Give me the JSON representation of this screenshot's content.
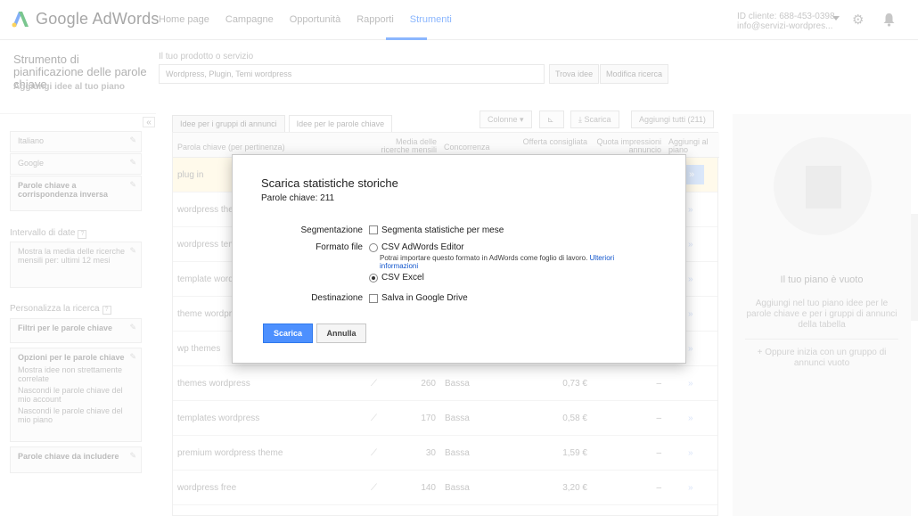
{
  "header": {
    "logo_text": "Google AdWords",
    "nav": [
      "Home page",
      "Campagne",
      "Opportunità",
      "Rapporti",
      "Strumenti"
    ],
    "active_nav": "Strumenti",
    "account_id": "ID cliente: 688-453-0398",
    "account_email": "info@servizi-wordpres..."
  },
  "tool": {
    "title": "Strumento di pianificazione delle parole chiave",
    "subtitle": "Aggiungi idee al tuo piano",
    "product_label": "Il tuo prodotto o servizio",
    "product_value": "Wordpress, Plugin, Temi wordpress",
    "find_ideas": "Trova idee",
    "edit_search": "Modifica ricerca"
  },
  "sidebar": {
    "language": "Italiano",
    "network": "Google",
    "negative_keywords": "Parole chiave a corrispondenza inversa",
    "date_range_head": "Intervallo di date",
    "date_range_text": "Mostra la media delle ricerche mensili per: ultimi 12 mesi",
    "customize_head": "Personalizza la ricerca",
    "keyword_filters": "Filtri per le parole chiave",
    "keyword_options": "Opzioni per le parole chiave",
    "opt1": "Mostra idee non strettamente correlate",
    "opt2": "Nascondi le parole chiave del mio account",
    "opt3": "Nascondi le parole chiave del mio piano",
    "include_keywords": "Parole chiave da includere"
  },
  "main": {
    "tab_groups": "Idee per i gruppi di annunci",
    "tab_keywords": "Idee per le parole chiave",
    "columns_btn": "Colonne",
    "download_btn": "Scarica",
    "add_all_btn": "Aggiungi tutti (211)",
    "headers": {
      "keyword": "Parola chiave (per pertinenza)",
      "volume": "Media delle ricerche mensili",
      "competition": "Concorrenza",
      "bid": "Offerta consigliata",
      "share": "Quota impressioni annuncio",
      "add": "Aggiungi al piano"
    },
    "rows": [
      {
        "keyword": "plug in",
        "volume": "",
        "competition": "",
        "bid": "",
        "share": ""
      },
      {
        "keyword": "wordpress themes",
        "volume": "",
        "competition": "",
        "bid": "",
        "share": ""
      },
      {
        "keyword": "wordpress templates",
        "volume": "",
        "competition": "",
        "bid": "",
        "share": ""
      },
      {
        "keyword": "template wordpress",
        "volume": "",
        "competition": "",
        "bid": "",
        "share": ""
      },
      {
        "keyword": "theme wordpress",
        "volume": "",
        "competition": "",
        "bid": "",
        "share": ""
      },
      {
        "keyword": "wp themes",
        "volume": "",
        "competition": "",
        "bid": "",
        "share": ""
      },
      {
        "keyword": "themes wordpress",
        "volume": "260",
        "competition": "Bassa",
        "bid": "0,73 €",
        "share": "–"
      },
      {
        "keyword": "templates wordpress",
        "volume": "170",
        "competition": "Bassa",
        "bid": "0,58 €",
        "share": "–"
      },
      {
        "keyword": "premium wordpress theme",
        "volume": "30",
        "competition": "Bassa",
        "bid": "1,59 €",
        "share": "–"
      },
      {
        "keyword": "wordpress free",
        "volume": "140",
        "competition": "Bassa",
        "bid": "3,20 €",
        "share": "–"
      }
    ]
  },
  "plan": {
    "empty_title": "Il tuo piano è vuoto",
    "empty_desc": "Aggiungi nel tuo piano idee per le parole chiave e per i gruppi di annunci della tabella",
    "alt_text": "+ Oppure inizia con un gruppo di annunci vuoto"
  },
  "dialog": {
    "title": "Scarica statistiche storiche",
    "keyword_count": "Parole chiave: 211",
    "segmentation_label": "Segmentazione",
    "segmentation_option": "Segmenta statistiche per mese",
    "format_label": "Formato file",
    "format_editor": "CSV AdWords Editor",
    "format_note": "Potrai importare questo formato in AdWords come foglio di lavoro.",
    "format_note_link": "Ulteriori informazioni",
    "format_excel": "CSV Excel",
    "destination_label": "Destinazione",
    "destination_option": "Salva in Google Drive",
    "download_button": "Scarica",
    "cancel_button": "Annulla"
  },
  "colors": {
    "accent": "#4d90fe",
    "link": "#1155cc",
    "highlight_row": "#fff8e1"
  }
}
